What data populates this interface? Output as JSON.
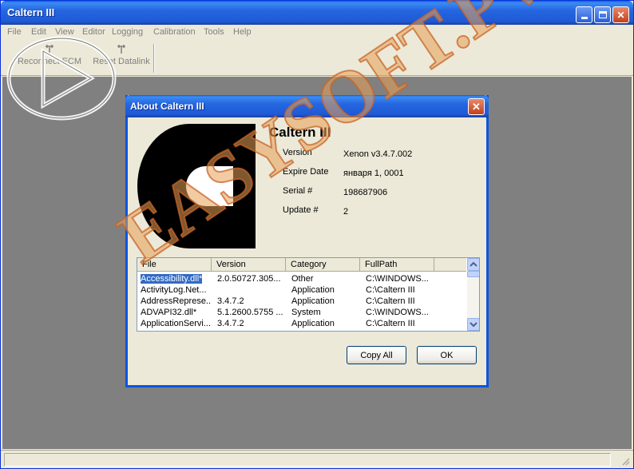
{
  "window": {
    "title": "Caltern III",
    "minimize_glyph": "",
    "close_glyph": "✕"
  },
  "menu": {
    "items": [
      "File",
      "Edit",
      "View",
      "Editor",
      "Logging",
      "Calibration",
      "Tools",
      "Help"
    ]
  },
  "toolbar": {
    "reconnect_label": "Reconnect ECM",
    "reset_label": "Reset Datalink"
  },
  "dialog": {
    "title": "About Caltern III",
    "close_glyph": "✕",
    "product_name": "Caltern III",
    "info": [
      {
        "label": "Version",
        "value": "Xenon v3.4.7.002"
      },
      {
        "label": "Expire Date",
        "value": "января 1, 0001"
      },
      {
        "label": "Serial #",
        "value": "198687906"
      },
      {
        "label": "Update #",
        "value": "2"
      }
    ],
    "table": {
      "columns": [
        "File",
        "Version",
        "Category",
        "FullPath"
      ],
      "rows": [
        [
          "Accessibility.dll*",
          "2.0.50727.305...",
          "Other",
          "C:\\WINDOWS..."
        ],
        [
          "ActivityLog.Net...",
          "",
          "Application",
          "C:\\Caltern III"
        ],
        [
          "AddressReprese...",
          "3.4.7.2",
          "Application",
          "C:\\Caltern III"
        ],
        [
          "ADVAPI32.dll*",
          "5.1.2600.5755 ...",
          "System",
          "C:\\WINDOWS..."
        ],
        [
          "ApplicationServi...",
          "3.4.7.2",
          "Application",
          "C:\\Caltern III"
        ]
      ]
    },
    "copy_all_label": "Copy All",
    "ok_label": "OK"
  },
  "watermark": {
    "text": "EASYSOFT.PW"
  },
  "colors": {
    "titlebar": "#2566e0",
    "selection": "#316ac5",
    "watermark": "#e8a055"
  }
}
